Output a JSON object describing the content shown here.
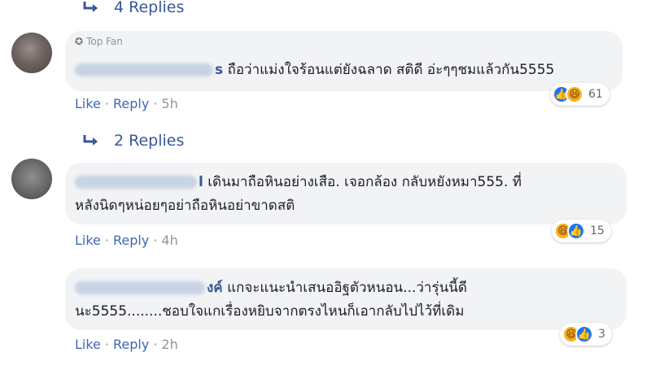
{
  "threads": [
    {
      "replies_label": "4 Replies",
      "top_fan_label": "Top Fan",
      "commenter_name_end": "s",
      "comment_text": "ถือว่าแม่งใจร้อนแต่ยังฉลาด สติดี อ่ะๆๆชมแล้วกัน5555",
      "reactions": [
        "like-icon",
        "haha-icon"
      ],
      "reaction_count": "61",
      "like_label": "Like",
      "reply_label": "Reply",
      "time": "5h"
    },
    {
      "replies_label": "2 Replies",
      "commenter_name_end": "l",
      "comment_line1": "เดินมาถือหินอย่างเสือ. เจอกล้อง กลับหยังหมา555. ที่",
      "comment_line2": "หลังนิดๆหน่อยๆอย่าถือหินอย่าขาดสติ",
      "reactions": [
        "haha-icon",
        "like-icon"
      ],
      "reaction_count": "15",
      "like_label": "Like",
      "reply_label": "Reply",
      "time": "4h"
    },
    {
      "commenter_name_end": "งค์",
      "comment_line1": "แกจะแนะนำเสนออิฐตัวหนอน...ว่ารุ่นนี้ดี",
      "comment_line2": "นะ5555........ชอบใจแกเรื่องหยิบจากตรงไหนก็เอากลับไปไว้ที่เดิม",
      "reactions": [
        "haha-icon",
        "like-icon"
      ],
      "reaction_count": "3",
      "like_label": "Like",
      "reply_label": "Reply",
      "time": "2h"
    }
  ],
  "colors": {
    "link": "#385898",
    "bubble": "#f2f3f5",
    "meta": "#90949c"
  }
}
